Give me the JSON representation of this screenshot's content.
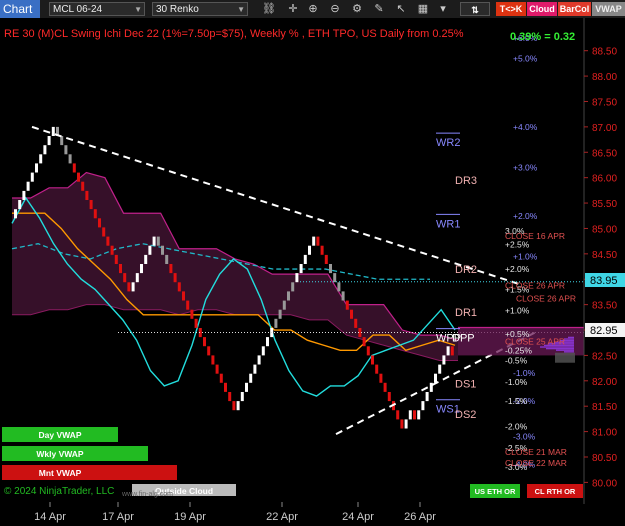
{
  "toolbar": {
    "app_button": "Chart",
    "symbol": "MCL 06-24",
    "bar_type": "30 Renko",
    "tk_button": "T<>K",
    "cloud_button": "Cloud",
    "barcol_button": "BarCol",
    "vwap_button": "VWAP",
    "icons": [
      "link-icon",
      "crosshair-icon",
      "zoom-in-icon",
      "zoom-out-icon",
      "indicators-icon",
      "draw-icon",
      "cursor-icon",
      "layout-icon",
      "more-icon"
    ]
  },
  "chart_title": "RE 30 (M)CL Swing Ichi Dec 22  (1%=7.50p=$75), Weekly % , ETH TPO, US Daily from 0.25%",
  "change_readout": "0.39% = 0.32",
  "price_axis": {
    "ticks": [
      "88.50",
      "88.00",
      "87.50",
      "87.00",
      "86.50",
      "86.00",
      "85.50",
      "85.00",
      "84.50",
      "84.00",
      "83.50",
      "83.00",
      "82.50",
      "82.00",
      "81.50",
      "81.00",
      "80.50",
      "80.00"
    ],
    "marker_cyan": "83.95",
    "marker_white": "82.95"
  },
  "date_axis": [
    "14 Apr",
    "17 Apr",
    "19 Apr",
    "22 Apr",
    "24 Apr",
    "26 Apr"
  ],
  "pivot_labels": [
    "WR2",
    "DR3",
    "WR1",
    "DR2",
    "DR1",
    "WPP",
    "DPP",
    "DS1",
    "WS1",
    "DS2"
  ],
  "pct_labels_weekly": [
    "+6.0%",
    "+5.0%",
    "+4.0%",
    "+3.0%",
    "+2.0%",
    "+1.0%",
    "-1.0%",
    "-2.0%",
    "-3.0%",
    "-4.0%"
  ],
  "pct_labels_daily": [
    "3.0%",
    "+2.5%",
    "+2.0%",
    "+1.5%",
    "+1.0%",
    "+0.5%",
    "-0.25%",
    "-0.5%",
    "-1.0%",
    "-1.5%",
    "-2.0%",
    "-2.5%",
    "-3.0%"
  ],
  "close_labels": [
    "CLOSE 16 APR",
    "CLOSE 26 APR",
    "CLOSE 26 APR",
    "CLOSE 25 APR",
    "CLOSE 21 MAR",
    "CLOSE 22 MAR"
  ],
  "vwap_buttons": [
    "Day VWAP",
    "Wkly VWAP",
    "Mnt VWAP"
  ],
  "outside_cloud": "Outside Cloud",
  "session_buttons": [
    "US ETH OR",
    "CL RTH OR"
  ],
  "copyright": "© 2024 NinjaTrader, LLC",
  "watermark": "www.fin-alg.com",
  "colors": {
    "up_bar": "#ffffff",
    "down_bar": "#e01010",
    "stale_bar": "#999999",
    "tenkan": "#22dddd",
    "kijun": "#ff9900",
    "cloud": "#5a1a45",
    "cloud_edge": "#c0208a",
    "trend_line": "#ffffff",
    "price_axis_text": "#e02020",
    "weekly_pct": "#8888ff",
    "daily_pct": "#ff8888",
    "day_vwap_btn": "#22bb22",
    "mnt_vwap_btn": "#cc1111"
  },
  "chart_data": {
    "type": "line",
    "title": "RE 30 (M)CL Swing Ichi Dec 22  (1%=7.50p=$75), Weekly % , ETH TPO, US Daily from 0.25%",
    "xlabel": "",
    "ylabel": "",
    "ylim": [
      79.85,
      88.75
    ],
    "x": [
      "14 Apr",
      "17 Apr",
      "19 Apr",
      "22 Apr",
      "24 Apr",
      "26 Apr"
    ],
    "renko_path": [
      85.2,
      86.2,
      87.0,
      86.2,
      85.5,
      85.2,
      84.4,
      83.8,
      84.4,
      84.9,
      84.3,
      83.5,
      82.6,
      82.3,
      82.0,
      81.8,
      81.5,
      81.9,
      82.4,
      83.0,
      84.0,
      84.7,
      84.9,
      84.3,
      83.6,
      82.8,
      82.0,
      81.5,
      81.1,
      81.4,
      81.2,
      81.7,
      82.3,
      82.6,
      82.1,
      81.5,
      81.0,
      81.5,
      82.0,
      82.5,
      82.8,
      82.5,
      82.5,
      82.6,
      82.8,
      82.9,
      83.2,
      83.8,
      84.1,
      83.7,
      83.3,
      82.95
    ],
    "series": [
      {
        "name": "Tenkan",
        "values": [
          85.1,
          85.6,
          85.2,
          84.7,
          84.3,
          84.0,
          83.8,
          83.5,
          83.2,
          82.8,
          82.2,
          81.9,
          82.0,
          82.7,
          83.6,
          84.1,
          84.4,
          84.2,
          83.6,
          82.8,
          82.2,
          81.8,
          81.7,
          81.9,
          81.9,
          82.1,
          82.5,
          82.6,
          82.7,
          82.8,
          83.1,
          83.4,
          83.0
        ]
      },
      {
        "name": "Kijun",
        "values": [
          85.3,
          85.3,
          85.3,
          85.0,
          84.6,
          84.3,
          84.0,
          83.6,
          83.3,
          83.3,
          83.3,
          83.3,
          83.3,
          83.3,
          83.3,
          83.3,
          83.0,
          83.0,
          82.8,
          82.7,
          82.6,
          82.6,
          82.9,
          82.9,
          82.6,
          82.7,
          82.8,
          82.7
        ]
      },
      {
        "name": "Cloud top",
        "values": [
          85.6,
          85.6,
          85.8,
          85.8,
          86.1,
          86.0,
          85.3,
          85.3,
          85.3,
          84.6,
          84.6,
          84.6,
          84.4,
          84.3,
          84.1,
          84.1,
          84.1,
          84.1,
          83.5,
          83.5,
          83.5,
          83.0,
          82.9,
          82.9,
          82.8
        ]
      },
      {
        "name": "Cloud bottom",
        "values": [
          83.3,
          83.3,
          83.4,
          83.4,
          83.5,
          83.5,
          83.4,
          83.4,
          83.4,
          83.3,
          83.4,
          83.4,
          83.3,
          83.3,
          83.3,
          83.3,
          83.2,
          83.2,
          82.9,
          82.8,
          82.7,
          82.6,
          82.5,
          82.4,
          82.4
        ]
      },
      {
        "name": "Chikou",
        "values": [
          84.6,
          84.7,
          84.5,
          84.4,
          84.6,
          84.7,
          84.6,
          84.5,
          84.4,
          84.3,
          84.2,
          84.2,
          84.2,
          84.1,
          84.0,
          84.0,
          84.0
        ]
      }
    ],
    "trend_lines": [
      [
        87.0,
        83.9
      ],
      [
        80.95,
        82.95
      ]
    ],
    "pivots": {
      "WR2": 86.7,
      "DR3": 85.95,
      "WR1": 85.1,
      "DR2": 84.2,
      "DR1": 83.35,
      "WPP": 82.85,
      "DPP": 82.85,
      "DS1": 81.95,
      "WS1": 81.45,
      "DS2": 81.35
    }
  }
}
